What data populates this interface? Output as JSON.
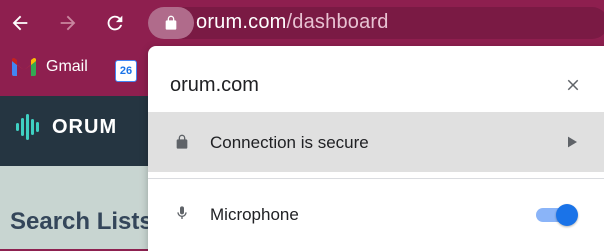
{
  "browser": {
    "url_domain": "orum.com",
    "url_path": "/dashboard",
    "back_icon": "arrow-left-icon",
    "forward_icon": "arrow-right-icon",
    "reload_icon": "reload-icon",
    "lock_icon": "lock-icon"
  },
  "bookmarks": [
    {
      "label": "Gmail",
      "icon": "gmail-icon"
    },
    {
      "label": "",
      "icon": "calendar-icon",
      "day": "26"
    }
  ],
  "app": {
    "logo_text": "ORUM",
    "page_heading": "Search Lists"
  },
  "site_info_popup": {
    "host": "orum.com",
    "close_icon": "close-icon",
    "connection_label": "Connection is secure",
    "microphone_label": "Microphone",
    "microphone_enabled": true
  },
  "colors": {
    "browser_chrome": "#8e1f4f",
    "app_header": "#253541",
    "toggle_on": "#1a73e8"
  }
}
